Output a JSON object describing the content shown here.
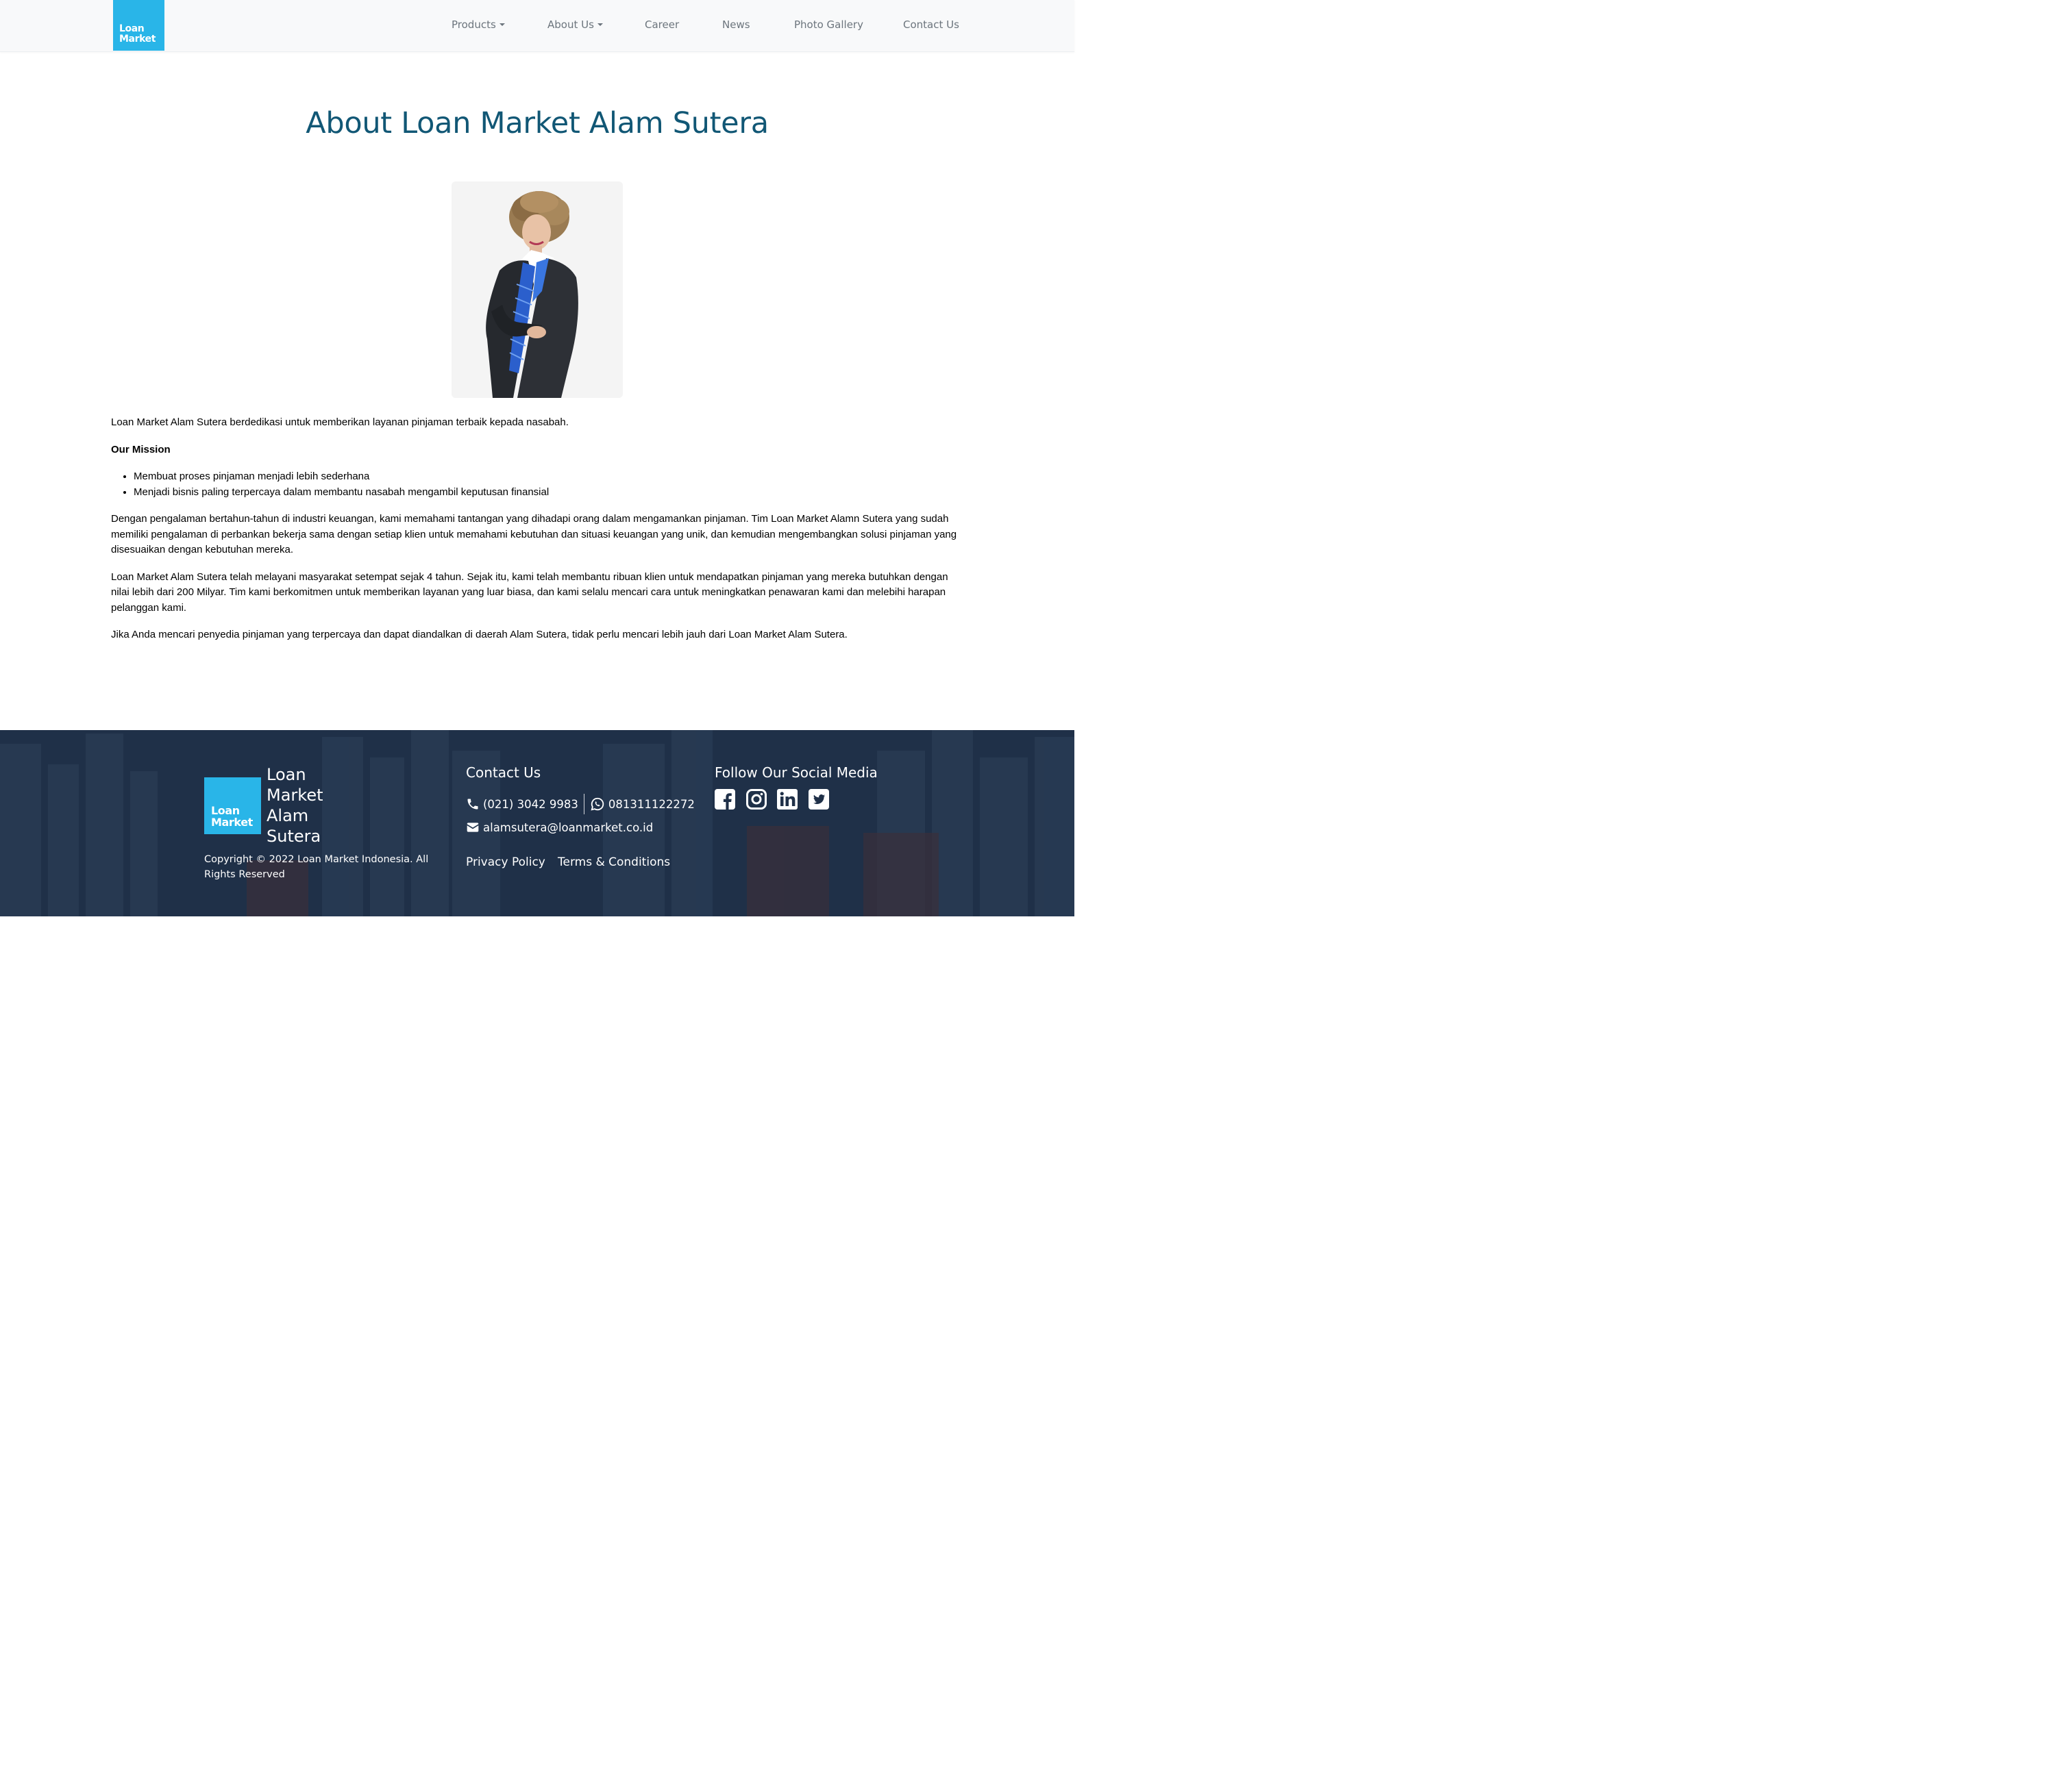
{
  "navbar": {
    "logo_line1": "Loan",
    "logo_line2": "Market",
    "items": [
      {
        "label": "Products",
        "dropdown": true
      },
      {
        "label": "About Us",
        "dropdown": true
      },
      {
        "label": "Career",
        "dropdown": false
      },
      {
        "label": "News",
        "dropdown": false
      },
      {
        "label": "Photo Gallery",
        "dropdown": false
      },
      {
        "label": "Contact Us",
        "dropdown": false
      }
    ]
  },
  "main": {
    "title": "About Loan Market Alam Sutera",
    "intro": "Loan Market Alam Sutera berdedikasi untuk memberikan layanan pinjaman terbaik kepada nasabah.",
    "mission_heading": "Our Mission",
    "mission_items": [
      "Membuat proses pinjaman menjadi lebih sederhana",
      "Menjadi bisnis paling terpercaya dalam membantu nasabah mengambil keputusan finansial"
    ],
    "paragraphs": [
      "Dengan pengalaman bertahun-tahun di industri keuangan, kami memahami tantangan yang dihadapi orang dalam mengamankan pinjaman. Tim Loan Market Alamn Sutera yang sudah memiliki pengalaman di perbankan bekerja sama dengan setiap klien untuk memahami kebutuhan dan situasi keuangan yang unik, dan kemudian mengembangkan solusi pinjaman yang disesuaikan dengan kebutuhan mereka.",
      "Loan Market Alam Sutera telah melayani masyarakat setempat sejak 4 tahun. Sejak itu, kami telah membantu ribuan klien untuk mendapatkan pinjaman yang mereka butuhkan dengan nilai lebih dari 200 Milyar. Tim kami berkomitmen untuk memberikan layanan yang luar biasa, dan kami selalu mencari cara untuk meningkatkan penawaran kami dan melebihi harapan pelanggan kami.",
      "Jika Anda mencari penyedia pinjaman yang terpercaya dan dapat diandalkan di daerah Alam Sutera, tidak perlu mencari lebih jauh dari Loan Market Alam Sutera."
    ]
  },
  "footer": {
    "logo_line1": "Loan",
    "logo_line2": "Market",
    "brand_name": [
      "Loan",
      "Market",
      "Alam",
      "Sutera"
    ],
    "copyright": "Copyright © 2022 Loan Market Indonesia. All Rights Reserved",
    "contact_heading": "Contact Us",
    "phone": "(021) 3042 9983",
    "whatsapp": "081311122272",
    "email": "alamsutera@loanmarket.co.id",
    "privacy_label": "Privacy Policy",
    "terms_label": "Terms & Conditions",
    "social_heading": "Follow Our Social Media",
    "social_icons": [
      "facebook-icon",
      "instagram-icon",
      "linkedin-icon",
      "twitter-icon"
    ]
  },
  "colors": {
    "brand_blue": "#29b5e8",
    "title_blue": "#115775",
    "footer_bg": "#1f3048",
    "nav_text": "#6c757d"
  }
}
